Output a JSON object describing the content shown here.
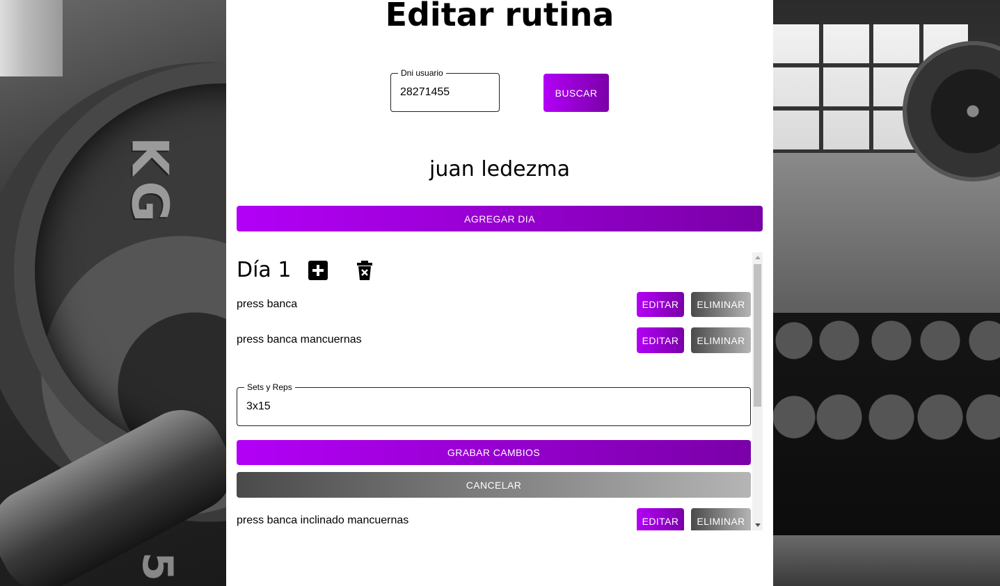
{
  "page": {
    "title": "Editar rutina"
  },
  "search": {
    "label": "Dni usuario",
    "value": "28271455",
    "button_label": "BUSCAR"
  },
  "user": {
    "name": "juan ledezma"
  },
  "add_day_label": "AGREGAR DIA",
  "day": {
    "title": "Día 1",
    "add_icon": "plus-square-icon",
    "delete_icon": "trash-x-icon",
    "exercises": [
      {
        "name": "press banca",
        "edit_label": "EDITAR",
        "delete_label": "ELIMINAR"
      },
      {
        "name": "press banca mancuernas",
        "edit_label": "EDITAR",
        "delete_label": "ELIMINAR"
      },
      {
        "name": "press banca inclinado mancuernas",
        "edit_label": "EDITAR",
        "delete_label": "ELIMINAR"
      }
    ]
  },
  "edit_form": {
    "label": "Sets y Reps",
    "value": "3x15",
    "save_label": "GRABAR CAMBIOS",
    "cancel_label": "CANCELAR"
  },
  "colors": {
    "accent_start": "#b300f7",
    "accent_end": "#7a00a8",
    "grey_start": "#4a4a4a",
    "grey_end": "#b5b5b5"
  }
}
